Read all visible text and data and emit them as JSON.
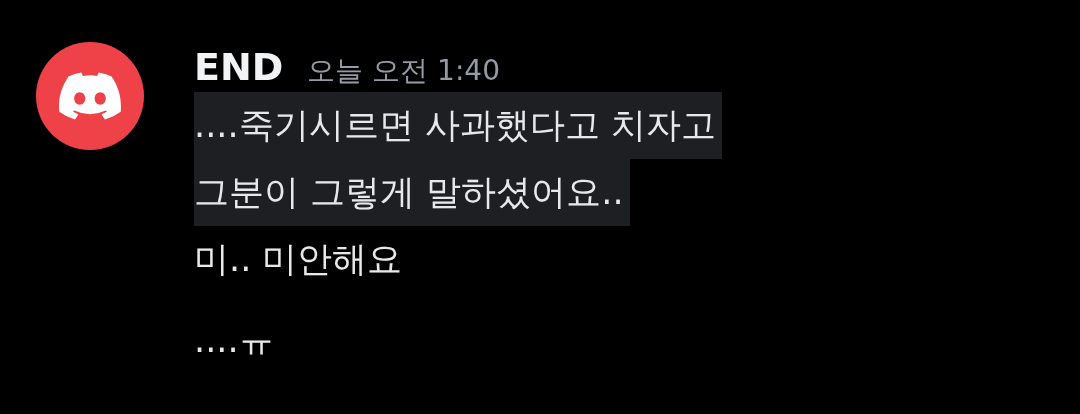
{
  "author": {
    "name": "END",
    "timestamp": "오늘 오전 1:40"
  },
  "messages": [
    {
      "text": "....죽기시르면 사과했다고 치자고",
      "highlighted": true
    },
    {
      "text": "그분이 그렇게 말하셨어요..",
      "highlighted": true
    },
    {
      "text": "미.. 미안해요",
      "highlighted": false
    },
    {
      "text": "....ㅠ",
      "highlighted": false
    }
  ]
}
